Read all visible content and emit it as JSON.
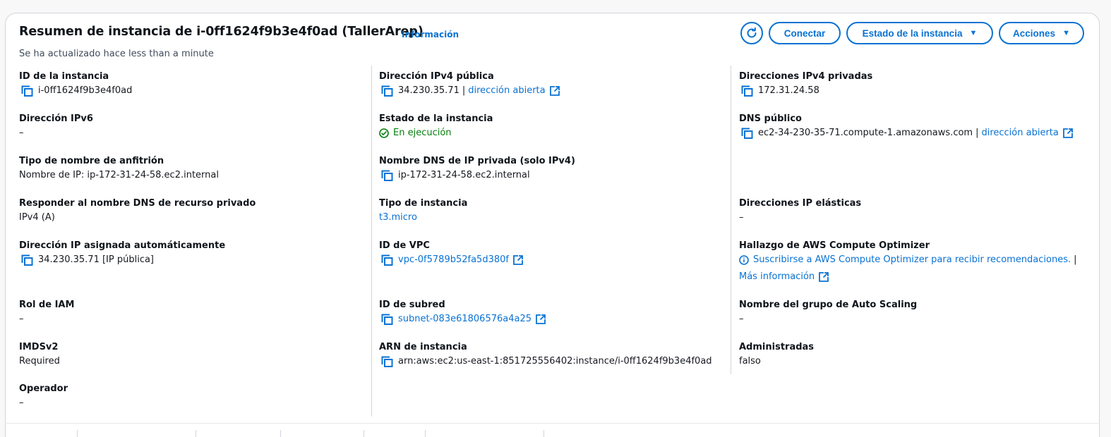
{
  "header": {
    "title": "Resumen de instancia de i-0ff1624f9b3e4f0ad (TallerArep)",
    "info_link": "Información",
    "subtitle": "Se ha actualizado hace less than a minute"
  },
  "actions": {
    "conectar": "Conectar",
    "estado": "Estado de la instancia",
    "acciones": "Acciones"
  },
  "col1": {
    "instance_id": {
      "label": "ID de la instancia",
      "value": "i-0ff1624f9b3e4f0ad"
    },
    "ipv6": {
      "label": "Dirección IPv6",
      "value": "–"
    },
    "hostname_type": {
      "label": "Tipo de nombre de anfitrión",
      "value": "Nombre de IP: ip-172-31-24-58.ec2.internal"
    },
    "dns_answer": {
      "label": "Responder al nombre DNS de recurso privado",
      "value": "IPv4 (A)"
    },
    "auto_ip": {
      "label": "Dirección IP asignada automáticamente",
      "value": "34.230.35.71 [IP pública]"
    },
    "iam_role": {
      "label": "Rol de IAM",
      "value": "–"
    },
    "imdsv2": {
      "label": "IMDSv2",
      "value": "Required"
    },
    "operator": {
      "label": "Operador",
      "value": "–"
    }
  },
  "col2": {
    "public_ipv4": {
      "label": "Dirección IPv4 pública",
      "value": "34.230.35.71",
      "link": "dirección abierta"
    },
    "state": {
      "label": "Estado de la instancia",
      "value": "En ejecución"
    },
    "private_dns": {
      "label": "Nombre DNS de IP privada (solo IPv4)",
      "value": "ip-172-31-24-58.ec2.internal"
    },
    "instance_type": {
      "label": "Tipo de instancia",
      "value": "t3.micro"
    },
    "vpc": {
      "label": "ID de VPC",
      "value": "vpc-0f5789b52fa5d380f"
    },
    "subnet": {
      "label": "ID de subred",
      "value": "subnet-083e61806576a4a25"
    },
    "arn": {
      "label": "ARN de instancia",
      "value": "arn:aws:ec2:us-east-1:851725556402:instance/i-0ff1624f9b3e4f0ad"
    }
  },
  "col3": {
    "private_ipv4": {
      "label": "Direcciones IPv4 privadas",
      "value": "172.31.24.58"
    },
    "public_dns": {
      "label": "DNS público",
      "value": "ec2-34-230-35-71.compute-1.amazonaws.com",
      "link": "dirección abierta"
    },
    "elastic_ip": {
      "label": "Direcciones IP elásticas",
      "value": "–"
    },
    "optimizer": {
      "label": "Hallazgo de AWS Compute Optimizer",
      "value": "Suscribirse a AWS Compute Optimizer para recibir recomendaciones.",
      "more": "Más información"
    },
    "asg": {
      "label": "Nombre del grupo de Auto Scaling",
      "value": "–"
    },
    "managed": {
      "label": "Administradas",
      "value": "falso"
    }
  },
  "colors": {
    "link": "#0972d3",
    "success": "#037f0c",
    "text": "#16191f",
    "border": "#d1d5db"
  }
}
